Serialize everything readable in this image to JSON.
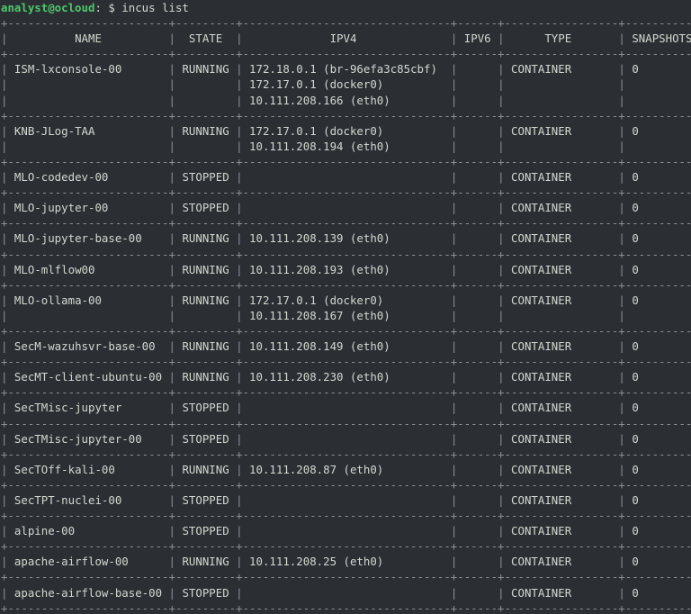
{
  "prompt": {
    "user_host": "analyst@ocloud",
    "colon": ":",
    "path": " $ ",
    "command": "incus list"
  },
  "table": {
    "columns": [
      "NAME",
      "STATE",
      "IPV4",
      "IPV6",
      "TYPE",
      "SNAPSHOTS"
    ],
    "rows": [
      {
        "name": "ISM-lxconsole-00",
        "state": "RUNNING",
        "ipv4": [
          "172.18.0.1 (br-96efa3c85cbf)",
          "172.17.0.1 (docker0)",
          "10.111.208.166 (eth0)"
        ],
        "ipv6": "",
        "type": "CONTAINER",
        "snapshots": "0"
      },
      {
        "name": "KNB-JLog-TAA",
        "state": "RUNNING",
        "ipv4": [
          "172.17.0.1 (docker0)",
          "10.111.208.194 (eth0)"
        ],
        "ipv6": "",
        "type": "CONTAINER",
        "snapshots": "0"
      },
      {
        "name": "MLO-codedev-00",
        "state": "STOPPED",
        "ipv4": [
          ""
        ],
        "ipv6": "",
        "type": "CONTAINER",
        "snapshots": "0"
      },
      {
        "name": "MLO-jupyter-00",
        "state": "STOPPED",
        "ipv4": [
          ""
        ],
        "ipv6": "",
        "type": "CONTAINER",
        "snapshots": "0"
      },
      {
        "name": "MLO-jupyter-base-00",
        "state": "RUNNING",
        "ipv4": [
          "10.111.208.139 (eth0)"
        ],
        "ipv6": "",
        "type": "CONTAINER",
        "snapshots": "0"
      },
      {
        "name": "MLO-mlflow00",
        "state": "RUNNING",
        "ipv4": [
          "10.111.208.193 (eth0)"
        ],
        "ipv6": "",
        "type": "CONTAINER",
        "snapshots": "0"
      },
      {
        "name": "MLO-ollama-00",
        "state": "RUNNING",
        "ipv4": [
          "172.17.0.1 (docker0)",
          "10.111.208.167 (eth0)"
        ],
        "ipv6": "",
        "type": "CONTAINER",
        "snapshots": "0"
      },
      {
        "name": "SecM-wazuhsvr-base-00",
        "state": "RUNNING",
        "ipv4": [
          "10.111.208.149 (eth0)"
        ],
        "ipv6": "",
        "type": "CONTAINER",
        "snapshots": "0"
      },
      {
        "name": "SecMT-client-ubuntu-00",
        "state": "RUNNING",
        "ipv4": [
          "10.111.208.230 (eth0)"
        ],
        "ipv6": "",
        "type": "CONTAINER",
        "snapshots": "0"
      },
      {
        "name": "SecTMisc-jupyter",
        "state": "STOPPED",
        "ipv4": [
          ""
        ],
        "ipv6": "",
        "type": "CONTAINER",
        "snapshots": "0"
      },
      {
        "name": "SecTMisc-jupyter-00",
        "state": "STOPPED",
        "ipv4": [
          ""
        ],
        "ipv6": "",
        "type": "CONTAINER",
        "snapshots": "0"
      },
      {
        "name": "SecTOff-kali-00",
        "state": "RUNNING",
        "ipv4": [
          "10.111.208.87 (eth0)"
        ],
        "ipv6": "",
        "type": "CONTAINER",
        "snapshots": "0"
      },
      {
        "name": "SecTPT-nuclei-00",
        "state": "STOPPED",
        "ipv4": [
          ""
        ],
        "ipv6": "",
        "type": "CONTAINER",
        "snapshots": "0"
      },
      {
        "name": "alpine-00",
        "state": "STOPPED",
        "ipv4": [
          ""
        ],
        "ipv6": "",
        "type": "CONTAINER",
        "snapshots": "0"
      },
      {
        "name": "apache-airflow-00",
        "state": "RUNNING",
        "ipv4": [
          "10.111.208.25 (eth0)"
        ],
        "ipv6": "",
        "type": "CONTAINER",
        "snapshots": "0"
      },
      {
        "name": "apache-airflow-base-00",
        "state": "STOPPED",
        "ipv4": [
          ""
        ],
        "ipv6": "",
        "type": "CONTAINER",
        "snapshots": "0"
      }
    ]
  },
  "colors": {
    "background": "#2b2f34",
    "text": "#d3d7cf",
    "prompt_user": "#4ec76a",
    "border": "#8a8f96"
  }
}
